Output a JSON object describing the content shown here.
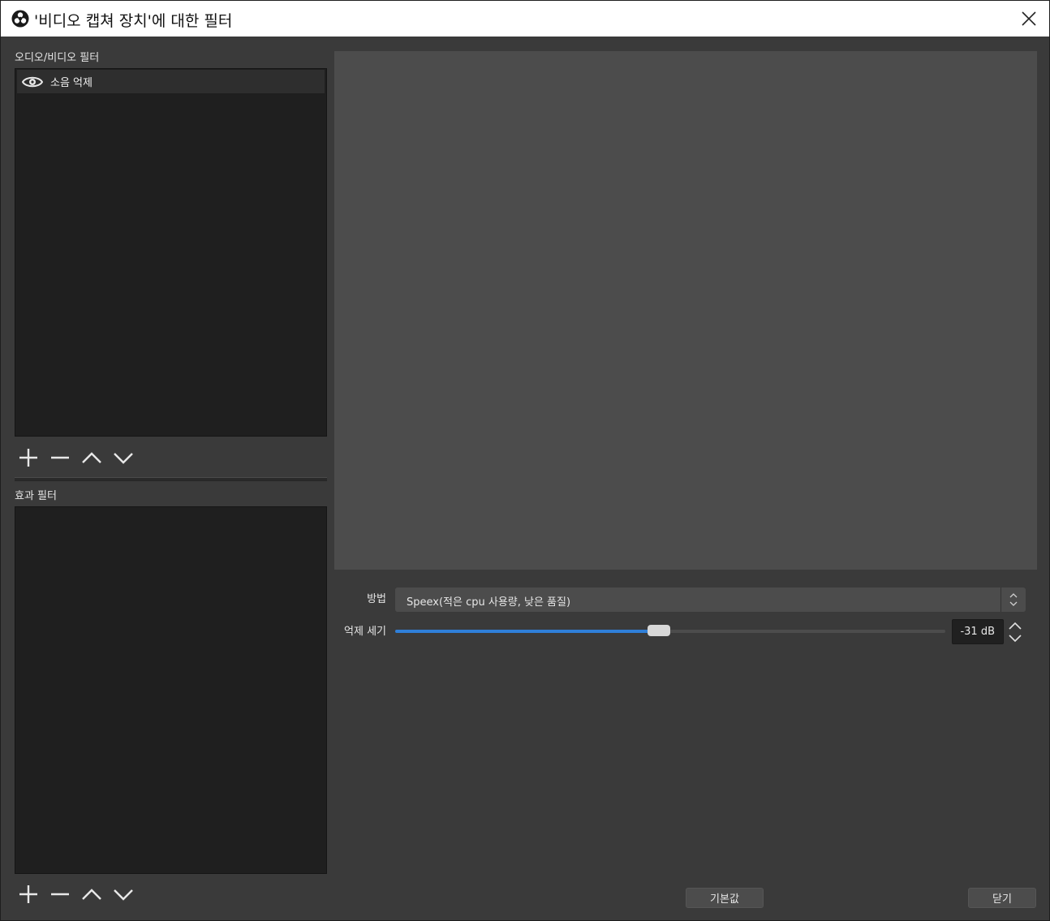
{
  "window": {
    "title": "'비디오 캡쳐 장치'에 대한 필터",
    "app_icon": "obs-logo-icon",
    "close_icon": "close-icon"
  },
  "audio_video_filters": {
    "label": "오디오/비디오 필터",
    "items": [
      {
        "name": "소음 억제",
        "visible_icon": "eye-icon",
        "enabled": true
      }
    ],
    "toolbar": [
      "add-icon",
      "remove-icon",
      "move-up-icon",
      "move-down-icon"
    ]
  },
  "effect_filters": {
    "label": "효과 필터",
    "items": [],
    "toolbar": [
      "add-icon",
      "remove-icon",
      "move-up-icon",
      "move-down-icon"
    ]
  },
  "properties": {
    "method": {
      "label": "방법",
      "value": "Speex(적은 cpu 사용량, 낮은 품질)"
    },
    "suppression": {
      "label": "억제 세기",
      "value_text": "-31 dB",
      "level_fraction": 0.48
    }
  },
  "buttons": {
    "defaults": "기본값",
    "close": "닫기"
  },
  "colors": {
    "accent": "#2f7fd9",
    "panel": "#3a3a3a",
    "list_bg": "#1f1f1f",
    "preview_bg": "#4c4c4c"
  }
}
